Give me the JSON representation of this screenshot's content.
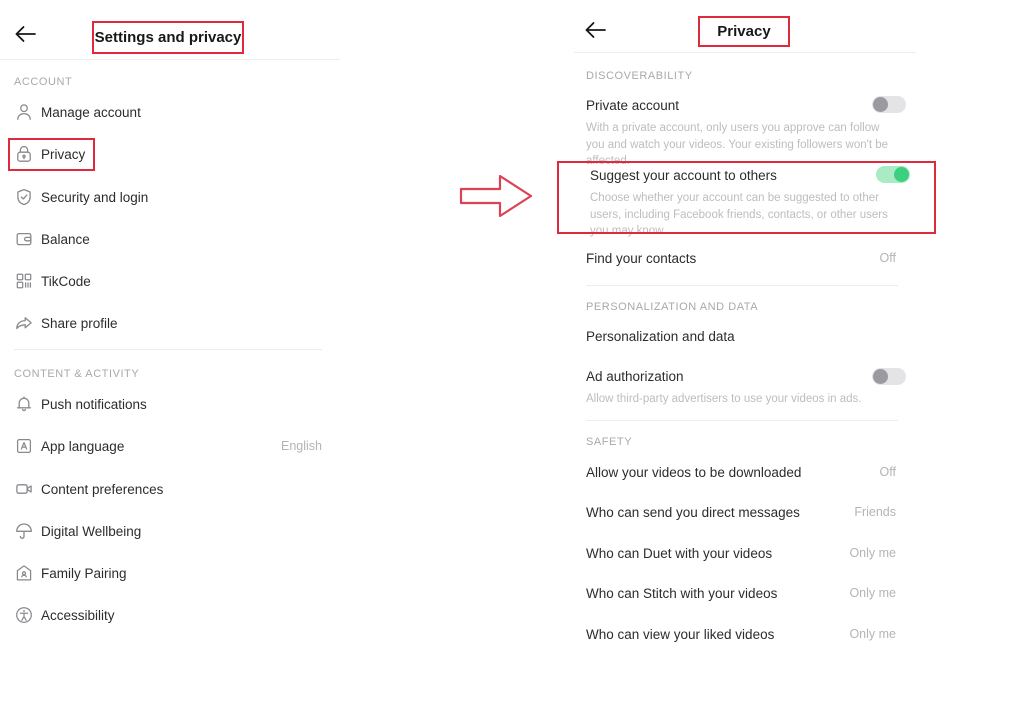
{
  "left_panel": {
    "back_icon": "back-arrow-icon",
    "title": "Settings and privacy",
    "sections": [
      {
        "label": "ACCOUNT",
        "items": [
          {
            "icon": "person-icon",
            "label": "Manage account",
            "value": ""
          },
          {
            "icon": "lock-icon",
            "label": "Privacy",
            "value": ""
          },
          {
            "icon": "shield-icon",
            "label": "Security and login",
            "value": ""
          },
          {
            "icon": "wallet-icon",
            "label": "Balance",
            "value": ""
          },
          {
            "icon": "qrcode-icon",
            "label": "TikCode",
            "value": ""
          },
          {
            "icon": "share-icon",
            "label": "Share profile",
            "value": ""
          }
        ]
      },
      {
        "label": "CONTENT & ACTIVITY",
        "items": [
          {
            "icon": "bell-icon",
            "label": "Push notifications",
            "value": ""
          },
          {
            "icon": "language-icon",
            "label": "App language",
            "value": "English"
          },
          {
            "icon": "video-icon",
            "label": "Content preferences",
            "value": ""
          },
          {
            "icon": "umbrella-icon",
            "label": "Digital Wellbeing",
            "value": ""
          },
          {
            "icon": "family-home-icon",
            "label": "Family Pairing",
            "value": ""
          },
          {
            "icon": "accessibility-icon",
            "label": "Accessibility",
            "value": ""
          }
        ]
      }
    ]
  },
  "right_panel": {
    "back_icon": "back-arrow-icon",
    "title": "Privacy",
    "sections": [
      {
        "label": "DISCOVERABILITY",
        "items": [
          {
            "label": "Private account",
            "description": "With a private account, only users you approve can follow you and watch your videos. Your existing followers won't be affected.",
            "control": "toggle",
            "toggle_state": "off",
            "value": ""
          },
          {
            "label": "Suggest your account to others",
            "description": "Choose whether your account can be suggested to other users, including Facebook friends, contacts, or other users you may know.",
            "control": "toggle",
            "toggle_state": "on",
            "value": ""
          },
          {
            "label": "Find your contacts",
            "description": "",
            "control": "value",
            "toggle_state": "",
            "value": "Off"
          }
        ]
      },
      {
        "label": "PERSONALIZATION AND DATA",
        "items": [
          {
            "label": "Personalization and data",
            "description": "",
            "control": "none",
            "toggle_state": "",
            "value": ""
          },
          {
            "label": "Ad authorization",
            "description": "Allow third-party advertisers to use your videos in ads.",
            "control": "toggle",
            "toggle_state": "off",
            "value": ""
          }
        ]
      },
      {
        "label": "SAFETY",
        "items": [
          {
            "label": "Allow your videos to be downloaded",
            "description": "",
            "control": "value",
            "toggle_state": "",
            "value": "Off"
          },
          {
            "label": "Who can send you direct messages",
            "description": "",
            "control": "value",
            "toggle_state": "",
            "value": "Friends"
          },
          {
            "label": "Who can Duet with your videos",
            "description": "",
            "control": "value",
            "toggle_state": "",
            "value": "Only me"
          },
          {
            "label": "Who can Stitch with your videos",
            "description": "",
            "control": "value",
            "toggle_state": "",
            "value": "Only me"
          },
          {
            "label": "Who can view your liked videos",
            "description": "",
            "control": "value",
            "toggle_state": "",
            "value": "Only me"
          }
        ]
      }
    ]
  },
  "annotations": {
    "accent_color": "#dd2b3d",
    "arrow_icon": "right-block-arrow-icon",
    "highlight_left_title": "Settings and privacy",
    "highlight_left_item": "Privacy",
    "highlight_right_title": "Privacy",
    "highlight_right_item": "Suggest your account to others"
  },
  "colors": {
    "toggle_on_track": "#a9ebc5",
    "toggle_on_knob": "#3ccf7e",
    "toggle_off_track": "#e4e4e6",
    "toggle_off_knob": "#9a9aa0",
    "text_primary": "#2c2c30",
    "text_muted": "#b4b4b8",
    "divider": "#ededed"
  }
}
